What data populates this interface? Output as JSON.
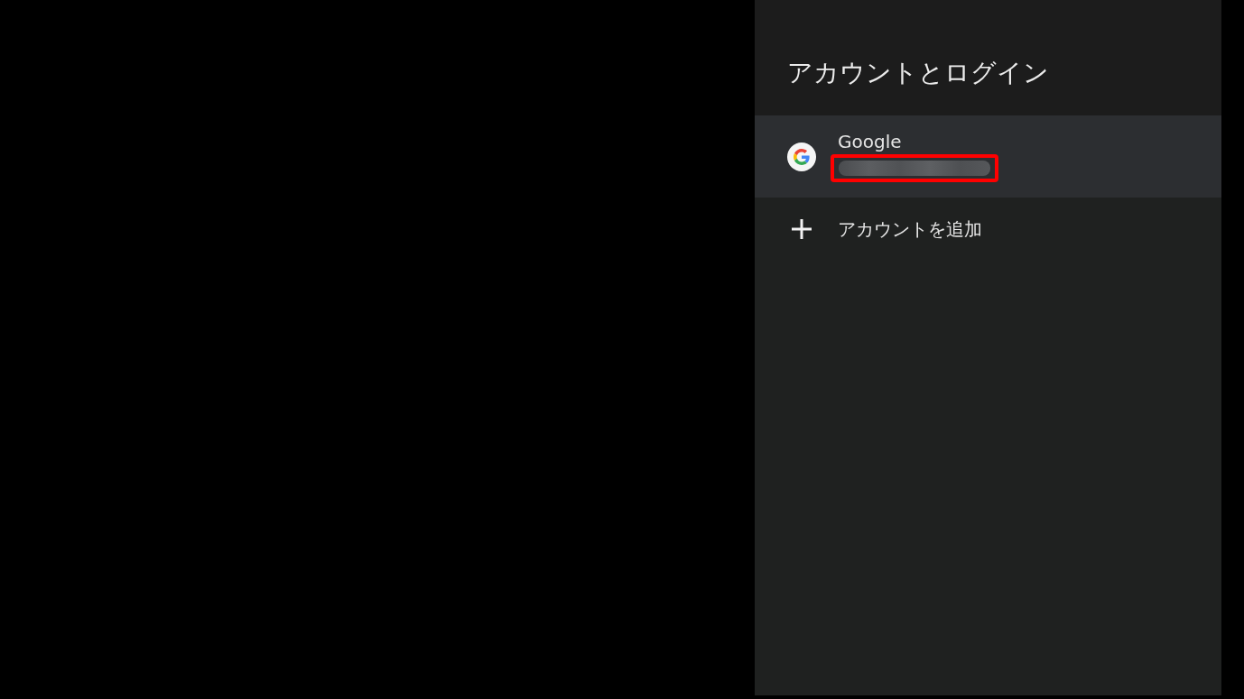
{
  "panel": {
    "title": "アカウントとログイン"
  },
  "items": [
    {
      "kind": "account",
      "label": "Google",
      "selected": true,
      "email_redacted": true,
      "highlighted": true
    },
    {
      "kind": "add",
      "label": "アカウントを追加",
      "selected": false
    }
  ]
}
